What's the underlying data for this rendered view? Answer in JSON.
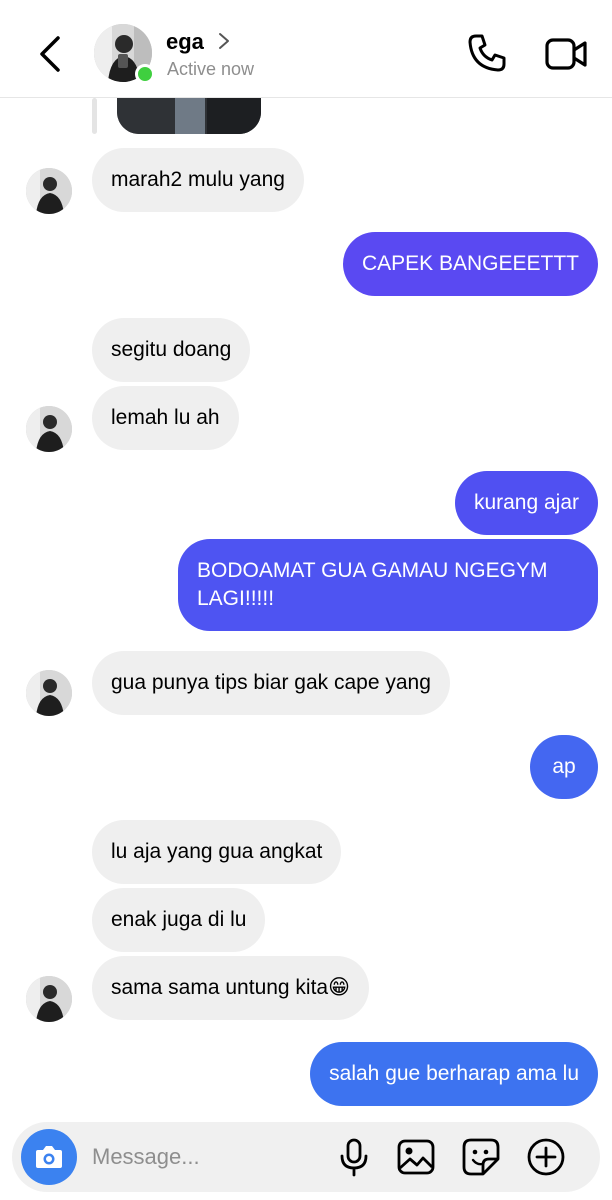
{
  "header": {
    "name": "ega",
    "status": "Active now",
    "back_icon": "chevron-left-icon",
    "call_icon": "phone-icon",
    "video_icon": "video-camera-icon"
  },
  "colors": {
    "incoming_bubble": "#efefef",
    "online": "#3fcf3f",
    "outgoing_gradient": [
      "#5b49f2",
      "#4f53f2",
      "#3d73f0"
    ],
    "camera_button": "#3b82f0"
  },
  "messages": [
    {
      "side": "in",
      "text": "marah2 mulu yang"
    },
    {
      "side": "out",
      "text": "CAPEK BANGEEETTT"
    },
    {
      "side": "in",
      "text": "segitu doang"
    },
    {
      "side": "in",
      "text": "lemah lu ah"
    },
    {
      "side": "out",
      "text": "kurang ajar"
    },
    {
      "side": "out",
      "text": "BODOAMAT GUA GAMAU NGEGYM LAGI!!!!!"
    },
    {
      "side": "in",
      "text": "gua punya tips biar gak cape yang"
    },
    {
      "side": "out",
      "text": "ap"
    },
    {
      "side": "in",
      "text": "lu aja yang gua angkat"
    },
    {
      "side": "in",
      "text": "enak juga di lu"
    },
    {
      "side": "in",
      "text": "sama sama untung kita😁"
    },
    {
      "side": "out",
      "text": "salah gue berharap ama lu"
    }
  ],
  "composer": {
    "placeholder": "Message...",
    "camera_icon": "camera-icon",
    "mic_icon": "microphone-icon",
    "gallery_icon": "image-icon",
    "sticker_icon": "sticker-icon",
    "add_icon": "plus-circle-icon"
  }
}
